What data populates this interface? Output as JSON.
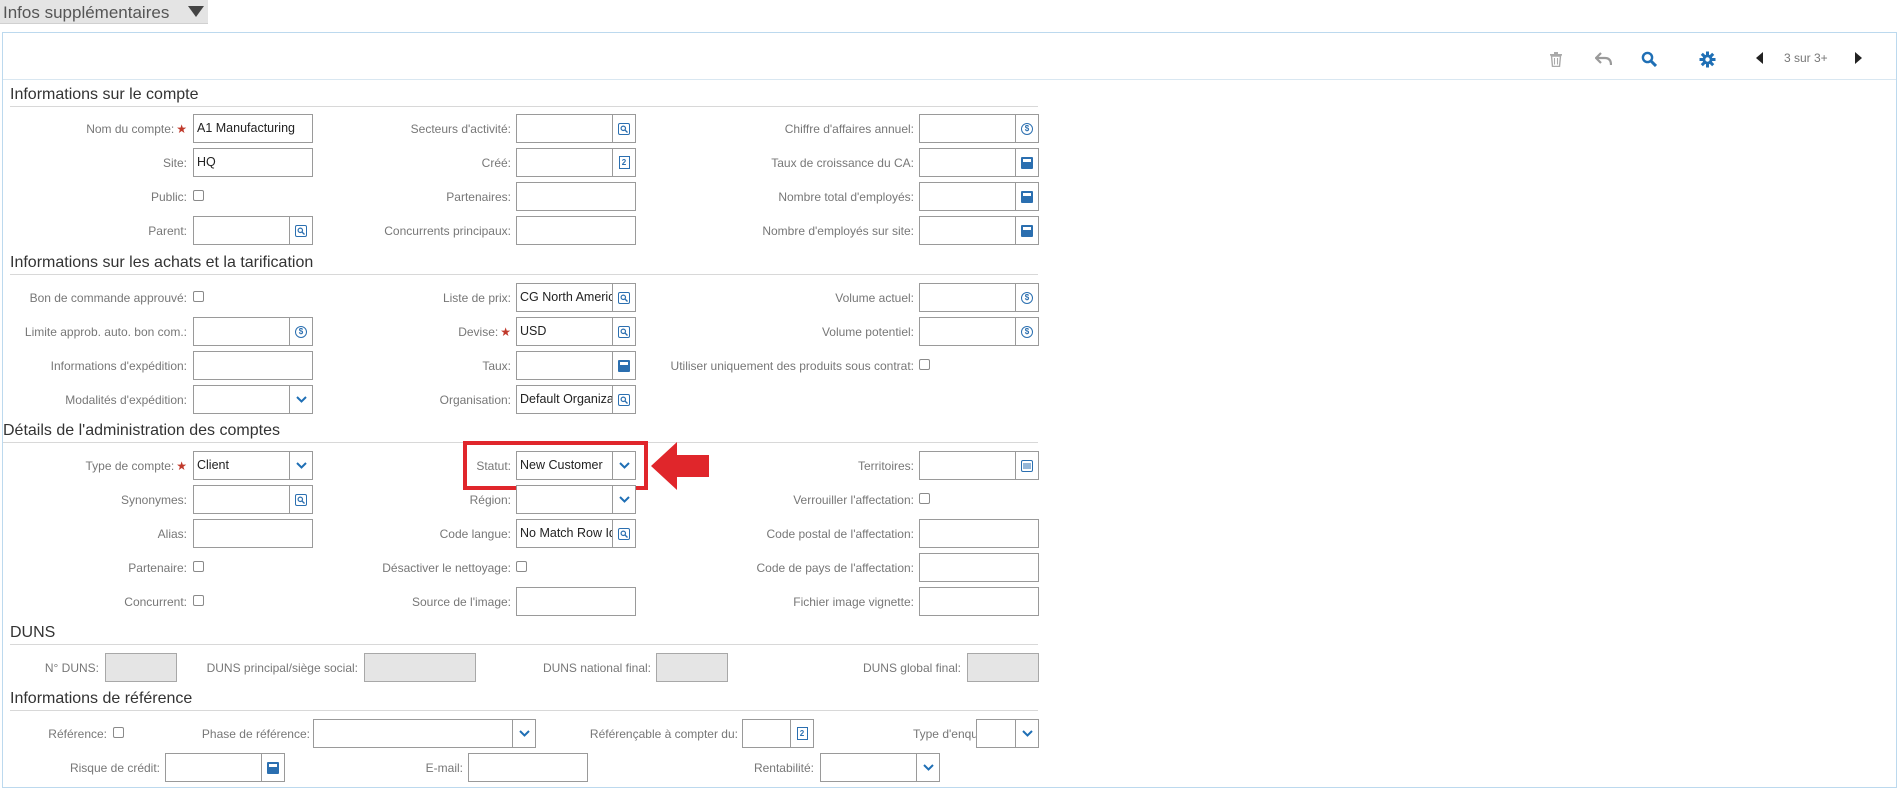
{
  "header": {
    "title": "Infos supplémentaires"
  },
  "toolbar": {
    "pager_text": "3 sur 3+"
  },
  "sections": {
    "account": "Informations sur le compte",
    "purchasing": "Informations sur les achats et la tarification",
    "admin": "Détails de l'administration des comptes",
    "duns": "DUNS",
    "reference": "Informations de référence"
  },
  "labels": {
    "nom_compte": "Nom du compte:",
    "secteurs": "Secteurs d'activité:",
    "chiffre_affaires": "Chiffre d'affaires annuel:",
    "site": "Site:",
    "cree": "Créé:",
    "taux_croissance": "Taux de croissance du CA:",
    "public": "Public:",
    "partenaires": "Partenaires:",
    "nombre_total_employes": "Nombre total d'employés:",
    "parent": "Parent:",
    "concurrents_principaux": "Concurrents principaux:",
    "nombre_employes_site": "Nombre d'employés sur site:",
    "bon_commande": "Bon de commande approuvé:",
    "liste_prix": "Liste de prix:",
    "volume_actuel": "Volume actuel:",
    "limite_approb": "Limite approb. auto. bon com.:",
    "devise": "Devise:",
    "volume_potentiel": "Volume potentiel:",
    "infos_expedition": "Informations d'expédition:",
    "taux": "Taux:",
    "produits_contrat": "Utiliser uniquement des produits sous contrat:",
    "modalites_expedition": "Modalités d'expédition:",
    "organisation": "Organisation:",
    "type_compte": "Type de compte:",
    "statut": "Statut:",
    "territoires": "Territoires:",
    "synonymes": "Synonymes:",
    "region": "Région:",
    "verrouiller": "Verrouiller l'affectation:",
    "alias": "Alias:",
    "code_langue": "Code langue:",
    "code_postal": "Code postal de l'affectation:",
    "partenaire": "Partenaire:",
    "desactiver_nettoyage": "Désactiver le nettoyage:",
    "code_pays": "Code de pays de l'affectation:",
    "concurrent": "Concurrent:",
    "source_image": "Source de l'image:",
    "fichier_vignette": "Fichier image vignette:",
    "no_duns": "N° DUNS:",
    "duns_principal": "DUNS principal/siège social:",
    "duns_national": "DUNS national final:",
    "duns_global": "DUNS global final:",
    "reference": "Référence:",
    "phase_reference": "Phase de référence:",
    "referencable": "Référençable à compter du:",
    "type_enquete": "Type d'enquête:",
    "risque_credit": "Risque de crédit:",
    "email": "E-mail:",
    "rentabilite": "Rentabilité:"
  },
  "values": {
    "nom_compte": "A1 Manufacturing",
    "site": "HQ",
    "liste_prix": "CG North America",
    "devise": "USD",
    "organisation": "Default Organization",
    "type_compte": "Client",
    "statut": "New Customer",
    "code_langue": "No Match Row Id"
  },
  "icons": {
    "delete": "trash-icon",
    "undo": "undo-icon",
    "search": "search-icon",
    "settings": "gear-icon",
    "prev": "prev-icon",
    "next": "next-icon",
    "annotation": "red-arrow-icon"
  },
  "colors": {
    "accent": "#1f6fb5",
    "highlight": "#e0262b",
    "panel_border": "#bcd9ee"
  }
}
